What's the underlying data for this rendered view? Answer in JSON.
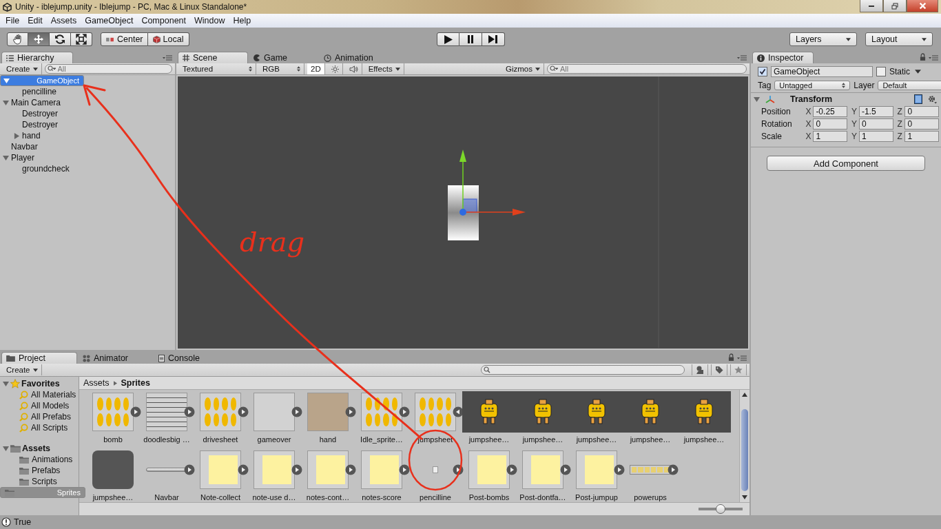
{
  "window": {
    "title": "Unity - iblejump.unity - Iblejump - PC, Mac & Linux Standalone*"
  },
  "menu": [
    "File",
    "Edit",
    "Assets",
    "GameObject",
    "Component",
    "Window",
    "Help"
  ],
  "toolbar": {
    "tools": [
      {
        "kind": "hand",
        "selected": false
      },
      {
        "kind": "move",
        "selected": true
      },
      {
        "kind": "rotate",
        "selected": false
      },
      {
        "kind": "scale",
        "selected": false
      }
    ],
    "pivot": [
      {
        "kind": "center",
        "label": "Center"
      },
      {
        "kind": "local",
        "label": "Local"
      }
    ],
    "playback": [
      {
        "kind": "play"
      },
      {
        "kind": "pause"
      },
      {
        "kind": "step"
      }
    ],
    "layers": "Layers",
    "layout": "Layout"
  },
  "hierarchy": {
    "tab": "Hierarchy",
    "create": "Create",
    "search_placeholder": "All",
    "items": [
      {
        "label": "GameObject",
        "expanded": true,
        "selected": true,
        "children": [
          {
            "label": "pencilline",
            "selected": false
          }
        ]
      },
      {
        "label": "Main Camera",
        "expanded": true,
        "selected": false,
        "children": [
          {
            "label": "Destroyer",
            "selected": false
          },
          {
            "label": "Destroyer",
            "selected": false
          },
          {
            "label": "hand",
            "expanded": false,
            "selected": false
          }
        ]
      },
      {
        "label": "Navbar",
        "selected": false
      },
      {
        "label": "Player",
        "expanded": true,
        "selected": false,
        "children": [
          {
            "label": "groundcheck",
            "selected": false
          }
        ]
      }
    ]
  },
  "scene": {
    "tabs": [
      {
        "label": "Scene",
        "kind": "scene",
        "selected": true
      },
      {
        "label": "Game",
        "kind": "game",
        "selected": false
      },
      {
        "label": "Animation",
        "kind": "animation",
        "selected": false
      }
    ],
    "render_mode": "Textured",
    "color_mode": "RGB",
    "mode_2d": {
      "label": "2D",
      "on": true
    },
    "effects": "Effects",
    "gizmos": "Gizmos",
    "search_placeholder": "All"
  },
  "inspector": {
    "tab": "Inspector",
    "active": true,
    "name": "GameObject",
    "static": {
      "label": "Static",
      "checked": false
    },
    "tag": {
      "label": "Tag",
      "value": "Untagged"
    },
    "layer": {
      "label": "Layer",
      "value": "Default"
    },
    "component": {
      "title": "Transform",
      "expanded": true,
      "rows": [
        {
          "label": "Position",
          "fields": [
            {
              "axis": "X",
              "value": "-0.25"
            },
            {
              "axis": "Y",
              "value": "-1.5"
            },
            {
              "axis": "Z",
              "value": "0"
            }
          ]
        },
        {
          "label": "Rotation",
          "fields": [
            {
              "axis": "X",
              "value": "0"
            },
            {
              "axis": "Y",
              "value": "0"
            },
            {
              "axis": "Z",
              "value": "0"
            }
          ]
        },
        {
          "label": "Scale",
          "fields": [
            {
              "axis": "X",
              "value": "1"
            },
            {
              "axis": "Y",
              "value": "1"
            },
            {
              "axis": "Z",
              "value": "1"
            }
          ]
        }
      ]
    },
    "add_component": "Add Component"
  },
  "project": {
    "tabs": [
      {
        "label": "Project",
        "kind": "project",
        "selected": true
      },
      {
        "label": "Animator",
        "kind": "animator",
        "selected": false
      },
      {
        "label": "Console",
        "kind": "console",
        "selected": false
      }
    ],
    "create": "Create",
    "tree": [
      {
        "label": "Favorites",
        "kind": "favorites",
        "expanded": true,
        "children": [
          {
            "label": "All Materials",
            "kind": "search",
            "selected": false
          },
          {
            "label": "All Models",
            "kind": "search",
            "selected": false
          },
          {
            "label": "All Prefabs",
            "kind": "search",
            "selected": false
          },
          {
            "label": "All Scripts",
            "kind": "search",
            "selected": false
          }
        ]
      },
      {
        "label": "Assets",
        "kind": "folder",
        "expanded": true,
        "children": [
          {
            "label": "Animations",
            "kind": "folder",
            "selected": false
          },
          {
            "label": "Prefabs",
            "kind": "folder",
            "selected": false
          },
          {
            "label": "Scripts",
            "kind": "folder",
            "selected": false
          },
          {
            "label": "Sprites",
            "kind": "folder",
            "selected": true
          }
        ]
      }
    ],
    "breadcrumb": [
      "Assets",
      "Sprites"
    ],
    "assets": [
      {
        "name": "bomb",
        "kind": "sheet",
        "expanded": false
      },
      {
        "name": "doodlesbig …",
        "kind": "sketch",
        "expanded": false
      },
      {
        "name": "drivesheet",
        "kind": "sheet",
        "expanded": false
      },
      {
        "name": "gameover",
        "kind": "blank",
        "expanded": false
      },
      {
        "name": "hand",
        "kind": "photo",
        "expanded": false
      },
      {
        "name": "Idle_sprite…",
        "kind": "sheet",
        "expanded": false
      },
      {
        "name": "jumpsheet",
        "kind": "sheet",
        "expanded": true
      },
      {
        "name": "jumpshee…",
        "kind": "subsprite"
      },
      {
        "name": "jumpshee…",
        "kind": "subsprite"
      },
      {
        "name": "jumpshee…",
        "kind": "subsprite"
      },
      {
        "name": "jumpshee…",
        "kind": "subsprite"
      },
      {
        "name": "jumpshee…",
        "kind": "subsprite"
      },
      {
        "name": "jumpshee…",
        "kind": "subsprite-last"
      },
      {
        "name": "Navbar",
        "kind": "bar",
        "expanded": false
      },
      {
        "name": "Note-collect",
        "kind": "note",
        "expanded": false
      },
      {
        "name": "note-use d…",
        "kind": "note",
        "expanded": false
      },
      {
        "name": "notes-cont…",
        "kind": "note",
        "expanded": false
      },
      {
        "name": "notes-score",
        "kind": "note",
        "expanded": false
      },
      {
        "name": "pencilline",
        "kind": "dot",
        "expanded": false
      },
      {
        "name": "Post-bombs",
        "kind": "note",
        "expanded": false
      },
      {
        "name": "Post-dontfa…",
        "kind": "note",
        "expanded": false
      },
      {
        "name": "Post-jumpup",
        "kind": "note",
        "expanded": false
      },
      {
        "name": "powerups",
        "kind": "strip",
        "expanded": false
      }
    ],
    "zoom": {
      "level": 0.5
    }
  },
  "status_bar": {
    "text": "True"
  },
  "annotation": {
    "text": "drag"
  }
}
